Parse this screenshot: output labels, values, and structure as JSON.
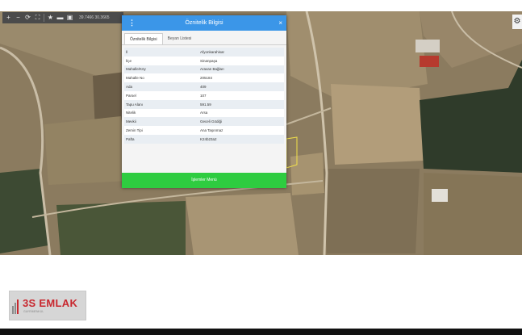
{
  "toolbar": {
    "coordinates": "39.7466 30.3665"
  },
  "dialog": {
    "title": "Öznitelik Bilgisi",
    "tabs": [
      {
        "label": "Öznitelik Bilgisi",
        "active": true
      },
      {
        "label": "Beyan Listesi",
        "active": false
      }
    ],
    "rows": [
      {
        "key": "İl",
        "value": "Afyonkarahisar"
      },
      {
        "key": "İlçe",
        "value": "Sinanpaşa"
      },
      {
        "key": "Mahalle/Köy",
        "value": "Aravan Bağları"
      },
      {
        "key": "Mahalle No",
        "value": "205184"
      },
      {
        "key": "Ada",
        "value": "409"
      },
      {
        "key": "Parsel",
        "value": "107"
      },
      {
        "key": "Tapu Alanı",
        "value": "591.59"
      },
      {
        "key": "Nitelik",
        "value": "Arsa"
      },
      {
        "key": "Mevkii",
        "value": "Geceli Gödiği"
      },
      {
        "key": "Zemin Tipi",
        "value": "Ana Taşınmaz"
      },
      {
        "key": "Pafta",
        "value": "K24b23a2"
      }
    ],
    "footer_label": "İşlemler Menü"
  },
  "logo": {
    "text": "3S EMLAK",
    "subtext": "GAYRİMENKUL"
  },
  "colors": {
    "header_blue": "#3b96e8",
    "footer_green": "#2ecc40",
    "logo_red": "#c8272e"
  }
}
